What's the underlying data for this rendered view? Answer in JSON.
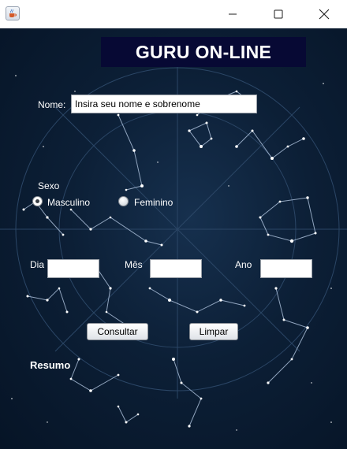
{
  "window": {
    "app_icon": "java-coffee-icon",
    "min_icon": "minimize-icon",
    "max_icon": "maximize-icon",
    "close_icon": "close-icon"
  },
  "header": {
    "title": "GURU ON-LINE"
  },
  "form": {
    "name_label": "Nome:",
    "name_value": "Insira seu nome e sobrenome",
    "sex_label": "Sexo",
    "sex_options": [
      {
        "label": "Masculino",
        "selected": true
      },
      {
        "label": "Feminino",
        "selected": false
      }
    ],
    "day_label": "Dia",
    "month_label": "Mês",
    "year_label": "Ano",
    "day_value": "",
    "month_value": "",
    "year_value": ""
  },
  "buttons": {
    "consultar": "Consultar",
    "limpar": "Limpar"
  },
  "summary_label": "Resumo",
  "colors": {
    "header_bg": "#070934",
    "sky_bg": "#0c1f36",
    "star": "#ffffff",
    "constellation_line": "#9fb4d0"
  }
}
